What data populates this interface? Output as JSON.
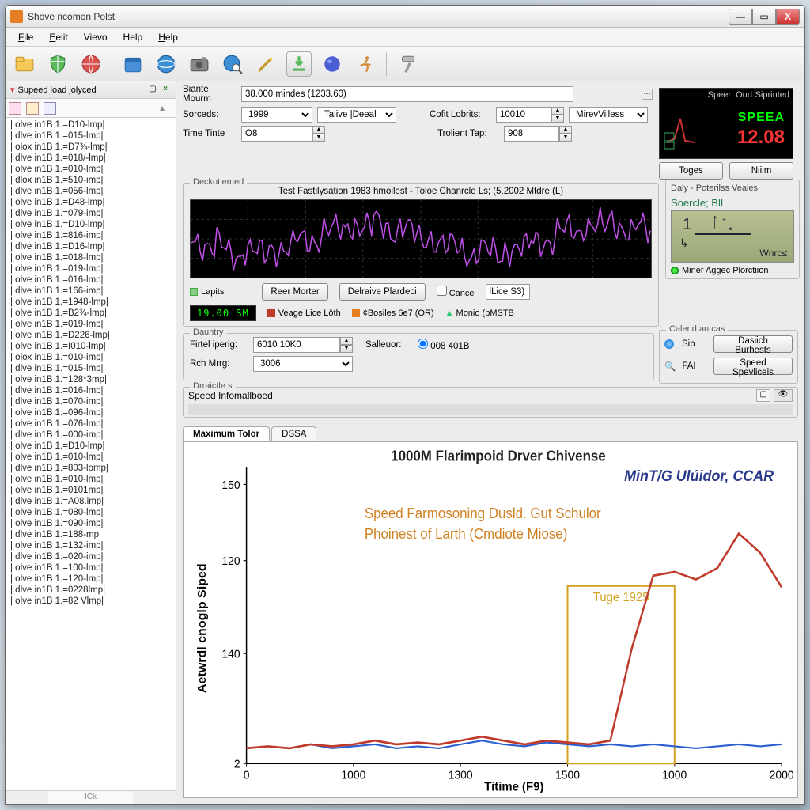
{
  "window": {
    "title": "Shove ncomon Polst"
  },
  "menu": {
    "file": "File",
    "edit": "Eelit",
    "view": "Vievo",
    "help1": "Help",
    "help2": "Help"
  },
  "sidebar": {
    "title": "Supeed load jolyced",
    "footer_label": "ICk",
    "items": [
      "| olve in1B 1.=D10-lmp|",
      "| dlve in1B 1.=015-lmp|",
      "| olox in1B 1.=D7¾-lmp|",
      "| dlve in1B 1.=018/-lmp|",
      "| olve in1B 1.=010-lmp|",
      "| dlox in1B 1.=510-imp|",
      "| dlve in1B 1.=056-lmp|",
      "| olve in1B 1.=D48-lmp|",
      "| dlve in1B 1.=079-imp|",
      "| olve in1B 1.=D10-lmp|",
      "| olve in1B 1.=816-imp|",
      "| dlve in1B 1.=D16-lmp|",
      "| olve in1B 1.=018-lmp|",
      "| olve in1B 1.=019-lmp|",
      "| olve in1B 1.=016-lmp|",
      "| dlve in1B 1.=166-imp|",
      "| olve in1B 1.=1948-lmp|",
      "| olve in1B 1.=B2¾-lmp|",
      "| olve in1B 1.=019-lmp|",
      "| olve in1B 1.=D226-lmp|",
      "| olve in1B 1.=I010-lmp|",
      "| olox in1B 1.=010-imp|",
      "| dlve in1B 1.=015-lmp|",
      "| olve in1B 1.=128*3mp|",
      "| dlve in1B 1.=016-lmp|",
      "| dlve in1B 1.=070-imp|",
      "| olve in1B 1.=096-lmp|",
      "| olve in1B 1.=076-lmp|",
      "| dlve in1B 1.=000-imp|",
      "| olve in1B 1.=D10-lmp|",
      "| olve in1B 1.=010-lmp|",
      "| dlve in1B 1.=803-lomp|",
      "| olve in1B 1.=010-lmp|",
      "| olve in1B 1.=0101mp|",
      "| dlve in1B 1.=A08.imp|",
      "| olve in1B 1.=080-lmp|",
      "| olve in1B 1.=090-imp|",
      "| dlve in1B 1.=188-mp|",
      "| olve in1B 1.=132-imp|",
      "| dlve in1B 1.=020-imp|",
      "| olve in1B 1.=100-lmp|",
      "| olve in1B 1.=120-lmp|",
      "| dlve in1B 1.=0228lmp|",
      "| olve in1B 1.=82 Vlmp|"
    ]
  },
  "params": {
    "header_label": "Biante Mourm",
    "header_value": "38.000 mindes (1233.60)",
    "sorceds_label": "Sorceds:",
    "sorceds_value": "1999",
    "mode_value": "Talive |Deeal",
    "timetinte_label": "Time Tinte",
    "timetinte_value": "O8",
    "cofit_label": "Cofit Lobrits:",
    "cofit_value": "10010",
    "mirev_value": "MirevViiless",
    "trolient_label": "Trolient Tap:",
    "trolient_value": "908"
  },
  "gauge": {
    "head": "Speer:  Ourt Siprinted",
    "word": "SPEEA",
    "value": "12.08"
  },
  "gauge_buttons": {
    "toges": "Toges",
    "niim": "Niiim"
  },
  "deck": {
    "legend": "Deckotiemed",
    "title": "Test Fastilysation 1983 hmollest - Toloe Chanrcle Ls;  (5.2002 Mtdre (L)",
    "lapits": "Lapits",
    "digital": "19.00 SM",
    "reer": "Reer Morter",
    "veage": "Veage Lice Löth",
    "delraive": "Delraive Plardeci",
    "cbosiles": "¢Bosiles 6e7 (OR)",
    "cance": "Cance",
    "lice": "lLice S3)",
    "monio": "Monio (bMSTB"
  },
  "right_panel": {
    "daly_title": "Daly - Poterilss Veales",
    "soercle": "Soercle; BlL",
    "miner": "Miner Aggec Plorctiion"
  },
  "dauntry": {
    "legend": "Dauntry",
    "firtel_label": "Firtel iperig:",
    "firtel_value": "6010 10K0",
    "salleuor_label": "Salleuor:",
    "salleuor_value": "008 401B",
    "rch_label": "Rch Mrrg:",
    "rch_value": "3006"
  },
  "calend": {
    "legend": "Calend an cas",
    "sip": "Sip",
    "dasiich": "Dasiich Burhests",
    "fai": "FAI",
    "speed": "Speed Spevliceis"
  },
  "draictes": {
    "legend": "Drraictle s",
    "speed_info": "Speed Infomallboed"
  },
  "tabs": {
    "t1": "Maximum Tolor",
    "t2": "DSSA"
  },
  "chart_data": {
    "type": "line",
    "title": "1000M Flarimpoid Drver Chivense",
    "subtitle": "MinT/G Ulúidor, CCAR",
    "annotation1": "Speed Farmosoning Dusld. Gut Schulor",
    "annotation2": "Phoinest of Larth (Cmdiote Miose)",
    "marker_label": "Tuge 1925",
    "xlabel": "Titime (F9)",
    "ylabel": "Aetwrdl cnoglp Siped",
    "x_ticks": [
      "0",
      "1000",
      "1300",
      "1500",
      "1000",
      "2000"
    ],
    "y_ticks": [
      "2",
      "140",
      "120",
      "150"
    ],
    "series": [
      {
        "name": "blue",
        "color": "#2a5fd0",
        "values": [
          8,
          9,
          8,
          10,
          8,
          9,
          10,
          8,
          9,
          8,
          10,
          12,
          10,
          9,
          11,
          10,
          9,
          10,
          9,
          10,
          9,
          8,
          9,
          10,
          9,
          10
        ]
      },
      {
        "name": "red",
        "color": "#c0392b",
        "values": [
          8,
          9,
          8,
          10,
          9,
          10,
          12,
          10,
          11,
          10,
          12,
          14,
          12,
          10,
          12,
          11,
          10,
          12,
          60,
          98,
          100,
          96,
          102,
          120,
          110,
          92
        ]
      }
    ],
    "marker_x_range": [
      0.6,
      0.8
    ]
  }
}
